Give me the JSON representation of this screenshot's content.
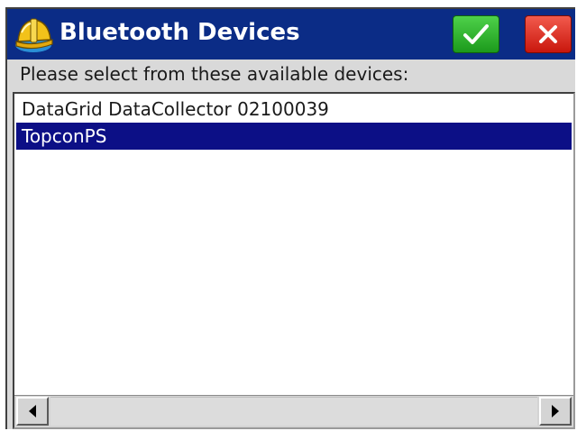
{
  "window": {
    "title": "Bluetooth Devices",
    "ok_icon": "checkmark-icon",
    "cancel_icon": "close-icon",
    "titlebar_color": "#0b2c86",
    "ok_color": "#2fb52c",
    "cancel_color": "#e0281c"
  },
  "prompt": "Please select from these available devices:",
  "devices": [
    {
      "name": "DataGrid DataCollector 02100039",
      "selected": false
    },
    {
      "name": "TopconPS",
      "selected": true
    }
  ],
  "selection_color": "#0c0f86",
  "scrollbar": {
    "left_icon": "triangle-left-icon",
    "right_icon": "triangle-right-icon"
  }
}
